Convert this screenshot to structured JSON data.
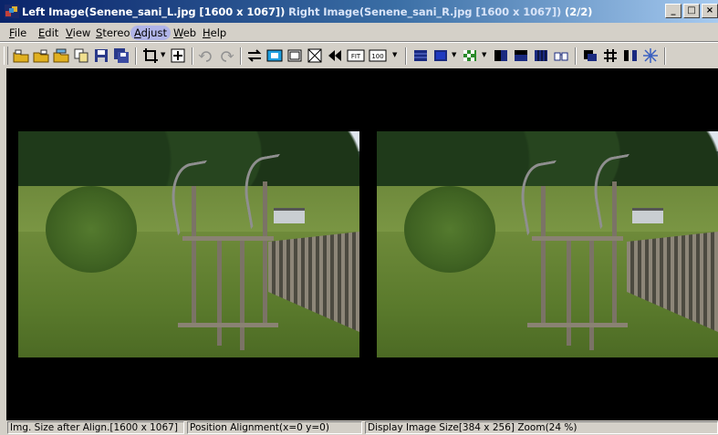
{
  "window": {
    "title_left": "Left Image(Senene_sani_L.jpg [1600 x 1067])",
    "title_right": "Right Image(Senene_sani_R.jpg [1600 x 1067])",
    "title_count": "(2/2)",
    "minimize": "_",
    "maximize": "□",
    "close": "×"
  },
  "menu": {
    "items": [
      {
        "label": "File",
        "underline": "F"
      },
      {
        "label": "Edit",
        "underline": "E"
      },
      {
        "label": "View",
        "underline": "V"
      },
      {
        "label": "Stereo",
        "underline": "S"
      },
      {
        "label": "Adjust",
        "underline": "A"
      },
      {
        "label": "Web",
        "underline": "W"
      },
      {
        "label": "Help",
        "underline": "H"
      }
    ]
  },
  "toolbar": {
    "fit_label": "FIT",
    "hundred_label": "100"
  },
  "images": {
    "left_name": "left-stereo-photo",
    "right_name": "right-stereo-photo"
  },
  "status": {
    "size_after_align": "Img. Size after Align.[1600 x 1067]",
    "position_alignment": "Position Alignment(x=0 y=0)",
    "display_size": "Display Image Size[384 x 256]  Zoom(24 %)"
  }
}
